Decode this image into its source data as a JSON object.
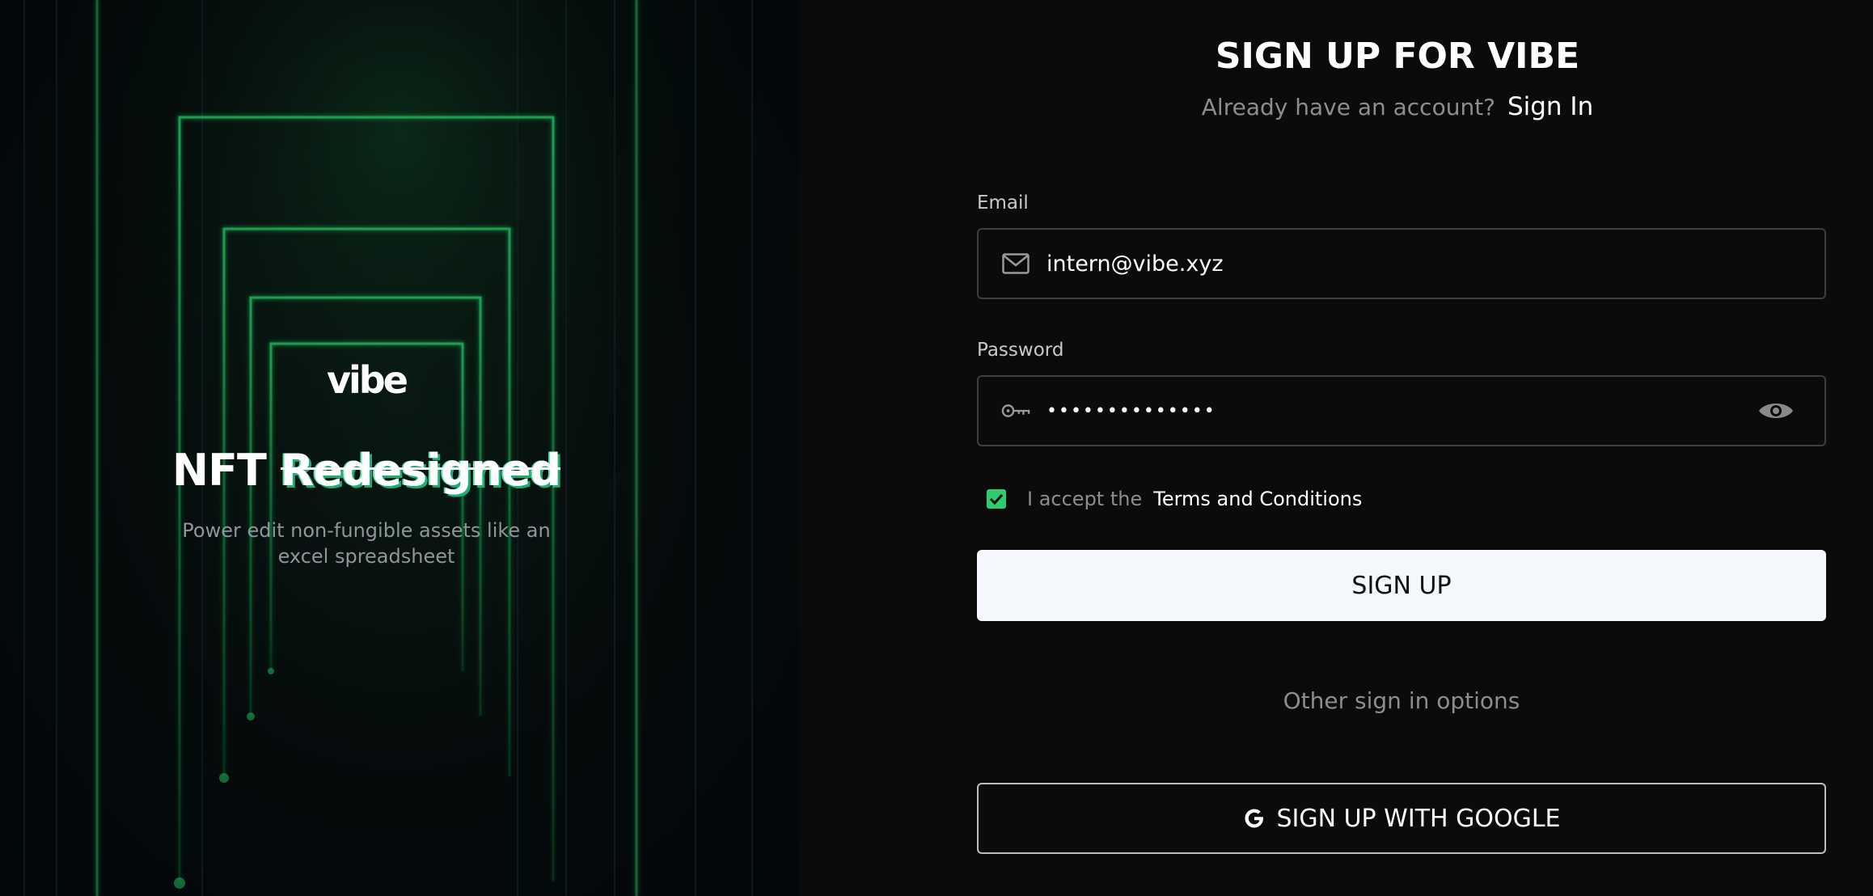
{
  "hero": {
    "brand": "vibe",
    "headline_prefix": "NFT",
    "headline_highlight": "Redesigned",
    "subtitle": "Power edit non-fungible assets like an excel spreadsheet"
  },
  "form": {
    "title": "SIGN UP FOR VIBE",
    "signin_prompt": "Already have an account?",
    "signin_link": "Sign In",
    "email": {
      "label": "Email",
      "value": "intern@vibe.xyz",
      "icon": "mail-icon"
    },
    "password": {
      "label": "Password",
      "value": "••••••••••••••",
      "icon": "key-icon",
      "toggle_icon": "eye-icon"
    },
    "terms": {
      "checked": true,
      "prefix": "I accept the",
      "link": "Terms and Conditions"
    },
    "submit_label": "SIGN UP",
    "divider_text": "Other sign in options",
    "google_label": "SIGN UP WITH GOOGLE",
    "google_icon": "google-icon"
  },
  "colors": {
    "accent_green": "#2ecc71",
    "primary_button_bg": "#f4f8fc",
    "panel_bg": "#0b0b0b"
  }
}
